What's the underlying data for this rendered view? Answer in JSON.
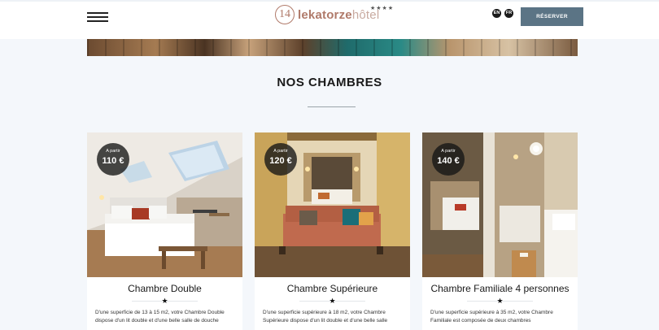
{
  "header": {
    "menu_icon": "hamburger-menu-icon",
    "logo": {
      "number": "14",
      "brand_bold": "lekatorze",
      "brand_light": "hôtel",
      "stars": "★★★★"
    },
    "languages": [
      "EN",
      "FR"
    ],
    "reserve_label": "RÉSERVER"
  },
  "section": {
    "title": "NOS CHAMBRES"
  },
  "rooms": [
    {
      "price_label": "A partir",
      "price": "110 €",
      "title": "Chambre Double",
      "star": "★",
      "description": "D'une superficie de 13 à 15 m2, votre Chambre Double dispose d'un lit double et d'une belle salle de douche"
    },
    {
      "price_label": "A partir",
      "price": "120 €",
      "title": "Chambre Supérieure",
      "star": "★",
      "description": "D'une superficie supérieure à 18 m2, votre Chambre Supérieure dispose d'un lit double et d'une belle salle"
    },
    {
      "price_label": "A partir",
      "price": "140 €",
      "title": "Chambre Familiale 4 personnes",
      "star": "★",
      "description": "D'une superficie supérieure à 35 m2, votre Chambre Familiale est composée de deux chambres"
    }
  ],
  "colors": {
    "accent": "#5b7485",
    "logo": "#b07a6a",
    "background": "#f4f7fb"
  }
}
